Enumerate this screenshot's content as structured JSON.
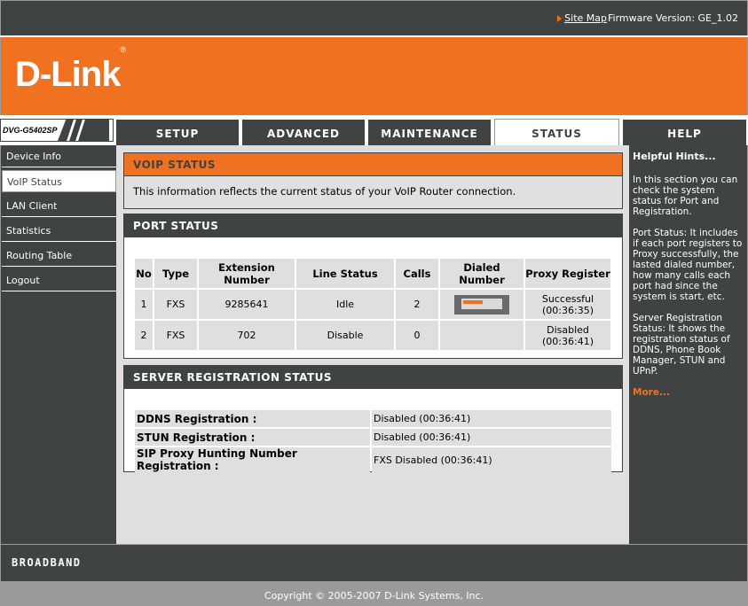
{
  "topbar": {
    "site_map": "Site Map",
    "firmware": "Firmware Version: GE_1.02"
  },
  "brand": {
    "logo": "D-Link",
    "model": "DVG-G5402SP"
  },
  "tabs": [
    {
      "label": "SETUP"
    },
    {
      "label": "ADVANCED"
    },
    {
      "label": "MAINTENANCE"
    },
    {
      "label": "STATUS"
    },
    {
      "label": "HELP"
    }
  ],
  "sidebar": {
    "items": [
      {
        "label": "Device Info"
      },
      {
        "label": "VoIP Status"
      },
      {
        "label": "LAN Client"
      },
      {
        "label": "Statistics"
      },
      {
        "label": "Routing Table"
      },
      {
        "label": "Logout"
      }
    ]
  },
  "voip_status": {
    "title": "VOIP STATUS",
    "description": "This information reflects the current status of your VoIP Router connection."
  },
  "port_status": {
    "title": "PORT STATUS",
    "columns": {
      "no": "No",
      "type": "Type",
      "ext": "Extension Number",
      "line": "Line Status",
      "calls": "Calls",
      "dialed": "Dialed Number",
      "proxy": "Proxy Register"
    },
    "rows": [
      {
        "no": "1",
        "type": "FXS",
        "ext": "9285641",
        "line": "Idle",
        "calls": "2",
        "proxy1": "Successful",
        "proxy2": "(00:36:35)"
      },
      {
        "no": "2",
        "type": "FXS",
        "ext": "702",
        "line": "Disable",
        "calls": "0",
        "proxy1": "Disabled",
        "proxy2": "(00:36:41)"
      }
    ]
  },
  "server_status": {
    "title": "SERVER REGISTRATION STATUS",
    "rows": [
      {
        "label": "DDNS Registration :",
        "value": "Disabled (00:36:41)"
      },
      {
        "label": "STUN Registration :",
        "value": "Disabled (00:36:41)"
      },
      {
        "label": "SIP Proxy Hunting Number Registration :",
        "value": "FXS Disabled (00:36:41)"
      }
    ]
  },
  "hints": {
    "title": "Helpful Hints...",
    "p1": "In this section you can check the system status for Port and Registration.",
    "p2": "Port Status: It includes if each port registers to Proxy successfully, the lasted dialed number, how many calls each port had since the system is start, etc.",
    "p3": "Server Registration Status: It shows the registration status of DDNS, Phone Book Manager, STUN and UPnP.",
    "more": "More..."
  },
  "footer": {
    "brand": "BROADBAND",
    "copyright": "Copyright © 2005-2007 D-Link Systems, Inc."
  }
}
